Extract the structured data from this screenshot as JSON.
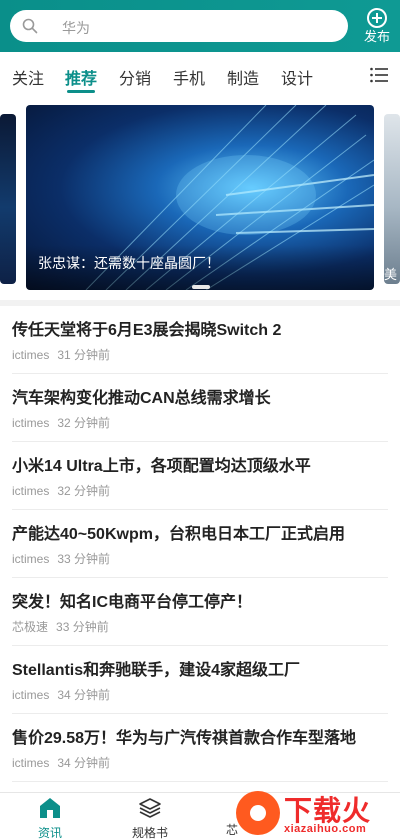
{
  "header": {
    "search_placeholder": "华为",
    "publish_label": "发布"
  },
  "tabs": [
    {
      "label": "关注",
      "active": false
    },
    {
      "label": "推荐",
      "active": true
    },
    {
      "label": "分销",
      "active": false
    },
    {
      "label": "手机",
      "active": false
    },
    {
      "label": "制造",
      "active": false
    },
    {
      "label": "设计",
      "active": false
    }
  ],
  "banner": {
    "caption": "张忠谋：还需数十座晶圆厂！",
    "side_stub": "美"
  },
  "news": [
    {
      "title": "传任天堂将于6月E3展会揭晓Switch 2",
      "source": "ictimes",
      "time": "31 分钟前"
    },
    {
      "title": "汽车架构变化推动CAN总线需求增长",
      "source": "ictimes",
      "time": "32 分钟前"
    },
    {
      "title": "小米14 Ultra上市，各项配置均达顶级水平",
      "source": "ictimes",
      "time": "32 分钟前"
    },
    {
      "title": "产能达40~50Kwpm，台积电日本工厂正式启用",
      "source": "ictimes",
      "time": "33 分钟前"
    },
    {
      "title": "突发！知名IC电商平台停工停产！",
      "source": "芯极速",
      "time": "33 分钟前"
    },
    {
      "title": "Stellantis和奔驰联手，建设4家超级工厂",
      "source": "ictimes",
      "time": "34 分钟前"
    },
    {
      "title": "售价29.58万！华为与广汽传祺首款合作车型落地",
      "source": "ictimes",
      "time": "34 分钟前"
    }
  ],
  "bottom_nav": [
    {
      "label": "资讯",
      "icon": "home-icon",
      "active": true
    },
    {
      "label": "规格书",
      "icon": "layers-icon",
      "active": false
    },
    {
      "label": "芯",
      "icon": "chip-icon",
      "active": false
    }
  ],
  "watermark": {
    "name": "下载火",
    "domain": "xiazaihuo.com"
  },
  "colors": {
    "accent": "#0c8f8a",
    "watermark": "#ef2b2b"
  }
}
